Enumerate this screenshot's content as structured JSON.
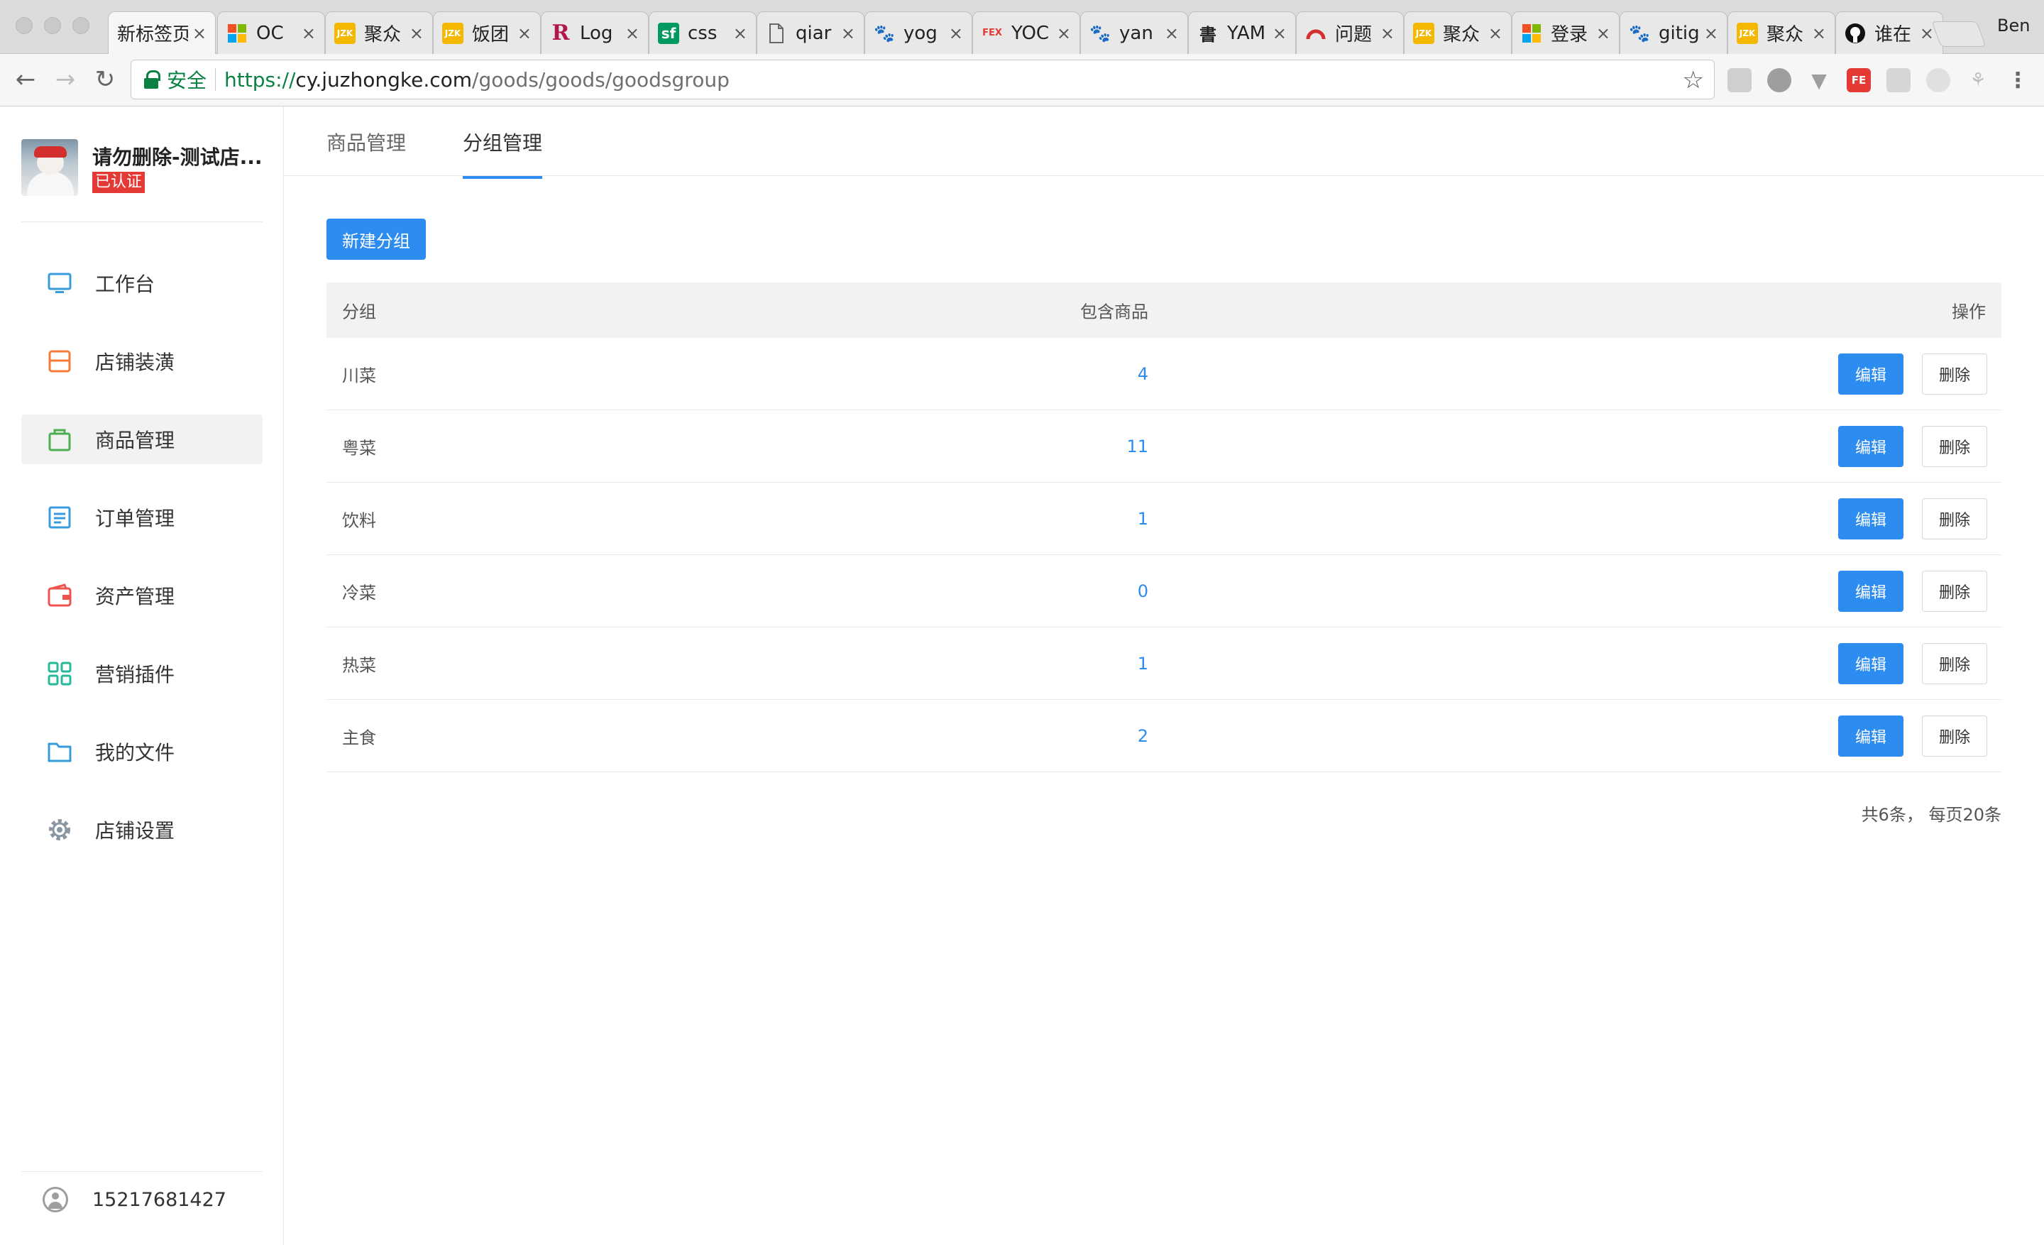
{
  "browser": {
    "tabs": [
      {
        "title": "新标签页",
        "icon": "new-tab-icon"
      },
      {
        "title": "OC",
        "icon": "microsoft-icon"
      },
      {
        "title": "聚众",
        "icon": "juzhong-icon"
      },
      {
        "title": "饭团",
        "icon": "juzhong-icon"
      },
      {
        "title": "Log",
        "icon": "r-logo-icon"
      },
      {
        "title": "css",
        "icon": "segmentfault-icon"
      },
      {
        "title": "qiar",
        "icon": "document-icon"
      },
      {
        "title": "yog",
        "icon": "baidu-paw-icon"
      },
      {
        "title": "YOC",
        "icon": "fex-icon"
      },
      {
        "title": "yan",
        "icon": "baidu-paw-icon"
      },
      {
        "title": "YAM",
        "icon": "calligraphy-icon"
      },
      {
        "title": "问题",
        "icon": "arc-icon"
      },
      {
        "title": "聚众",
        "icon": "juzhong-icon"
      },
      {
        "title": "登录",
        "icon": "microsoft-icon"
      },
      {
        "title": "gitig",
        "icon": "baidu-paw-icon"
      },
      {
        "title": "聚众",
        "icon": "juzhong-icon"
      },
      {
        "title": "谁在",
        "icon": "github-icon"
      }
    ],
    "profile_name": "Ben",
    "secure_label": "安全",
    "url": {
      "scheme": "https://",
      "host": "cy.juzhongke.com",
      "path": "/goods/goods/goodsgroup"
    },
    "colors": {
      "secure_green": "#0b8043",
      "chrome_bg": "#dcdcdc"
    }
  },
  "sidebar": {
    "shop_name": "请勿删除-测试店...",
    "badge": "已认证",
    "items": [
      {
        "label": "工作台",
        "icon": "monitor-icon"
      },
      {
        "label": "店铺装潢",
        "icon": "store-icon"
      },
      {
        "label": "商品管理",
        "icon": "bag-icon"
      },
      {
        "label": "订单管理",
        "icon": "order-list-icon"
      },
      {
        "label": "资产管理",
        "icon": "wallet-icon"
      },
      {
        "label": "营销插件",
        "icon": "plugin-grid-icon"
      },
      {
        "label": "我的文件",
        "icon": "folder-icon"
      },
      {
        "label": "店铺设置",
        "icon": "gear-icon"
      }
    ],
    "active_item": "商品管理",
    "user_phone": "15217681427"
  },
  "main": {
    "tabs": [
      {
        "label": "商品管理"
      },
      {
        "label": "分组管理"
      }
    ],
    "active_tab": "分组管理",
    "new_group_button": "新建分组",
    "table": {
      "headers": {
        "group": "分组",
        "count": "包含商品",
        "ops": "操作"
      },
      "rows": [
        {
          "group": "川菜",
          "count": "4"
        },
        {
          "group": "粤菜",
          "count": "11"
        },
        {
          "group": "饮料",
          "count": "1"
        },
        {
          "group": "冷菜",
          "count": "0"
        },
        {
          "group": "热菜",
          "count": "1"
        },
        {
          "group": "主食",
          "count": "2"
        }
      ],
      "edit_label": "编辑",
      "delete_label": "删除"
    },
    "pagination": "共6条， 每页20条",
    "colors": {
      "primary": "#2d8cf0",
      "badge_red": "#e53935"
    }
  }
}
